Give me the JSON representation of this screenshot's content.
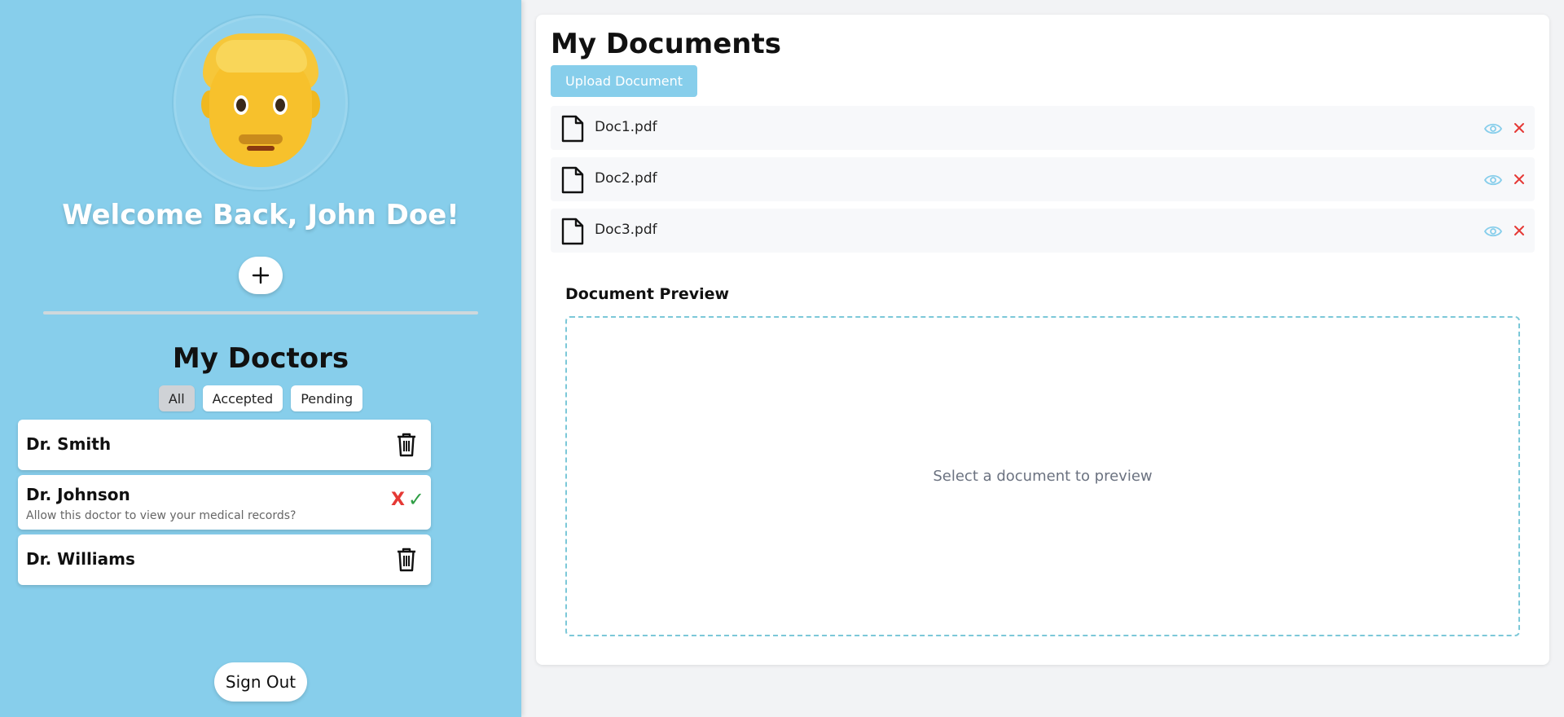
{
  "profile": {
    "welcome": "Welcome Back, John Doe!"
  },
  "doctors": {
    "title": "My Doctors",
    "filters": [
      "All",
      "Accepted",
      "Pending"
    ],
    "active_filter": "All",
    "items": [
      {
        "name": "Dr. Smith",
        "status": "accepted"
      },
      {
        "name": "Dr. Johnson",
        "status": "pending",
        "prompt": "Allow this doctor to view your medical records?"
      },
      {
        "name": "Dr. Williams",
        "status": "accepted"
      }
    ],
    "reject_glyph": "X",
    "accept_glyph": "✓"
  },
  "signout_label": "Sign Out",
  "documents": {
    "title": "My Documents",
    "upload_label": "Upload Document",
    "files": [
      {
        "name": "Doc1.pdf"
      },
      {
        "name": "Doc2.pdf"
      },
      {
        "name": "Doc3.pdf"
      }
    ]
  },
  "preview": {
    "title": "Document Preview",
    "placeholder": "Select a document to preview"
  },
  "colors": {
    "sidebar": "#87ceeb",
    "accent": "#87ceeb",
    "danger": "#e53935",
    "success": "#2e9e44"
  }
}
